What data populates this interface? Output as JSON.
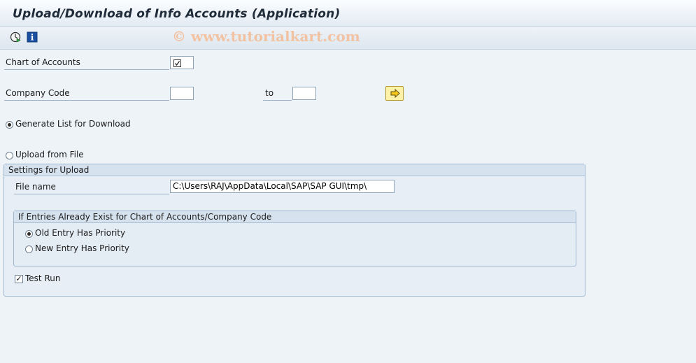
{
  "window": {
    "title": "Upload/Download of Info Accounts (Application)"
  },
  "watermark": "© www.tutorialkart.com",
  "toolbar": {
    "icons": [
      "execute-icon",
      "info-icon"
    ]
  },
  "form": {
    "chart_of_accounts": {
      "label": "Chart of Accounts",
      "value": ""
    },
    "company_code": {
      "label": "Company Code",
      "from": "",
      "to_label": "to",
      "to": ""
    },
    "generate_list": {
      "label": "Generate List for Download",
      "selected": true
    },
    "upload_file": {
      "label": "Upload from File",
      "selected": false
    }
  },
  "upload_settings": {
    "title": "Settings for Upload",
    "file_name_label": "File name",
    "file_name_value": "C:\\Users\\RAJ\\AppData\\Local\\SAP\\SAP GUI\\tmp\\",
    "priority_group": {
      "title": "If Entries Already Exist for Chart of Accounts/Company Code",
      "old_entry": "Old Entry Has Priority",
      "new_entry": "New Entry Has Priority"
    },
    "test_run": {
      "label": "Test Run",
      "checked": true
    }
  }
}
